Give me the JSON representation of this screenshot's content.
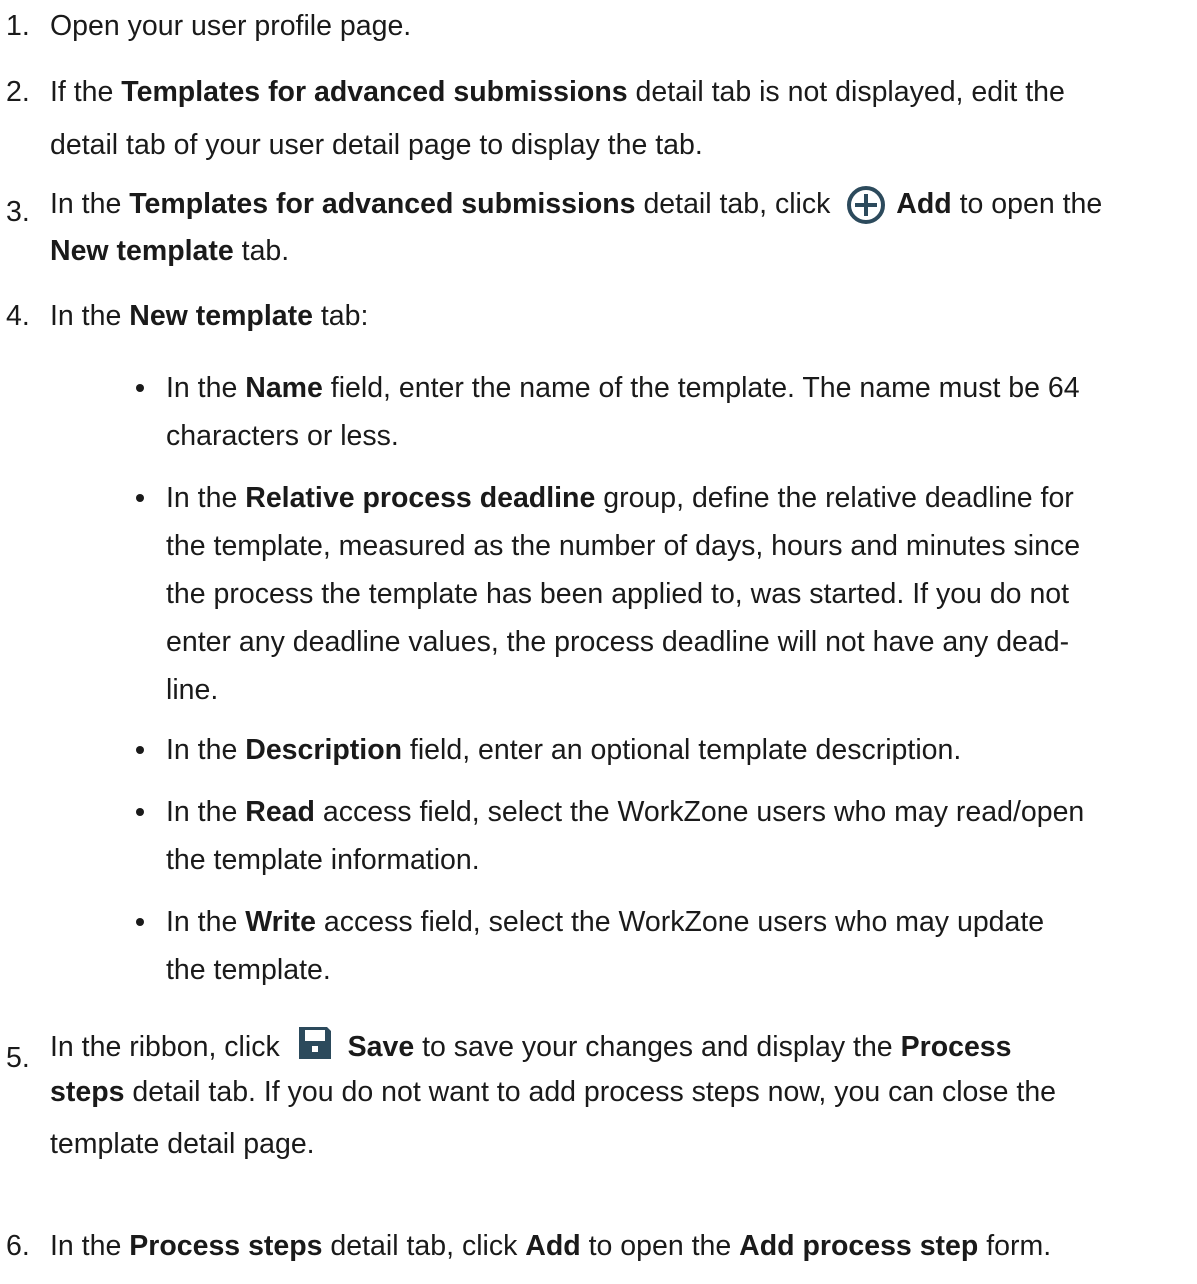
{
  "steps": [
    {
      "number": "1.",
      "text": "Open your user profile page."
    },
    {
      "number": "2.",
      "a": "If the ",
      "b1": "Templates for advanced submissions",
      "line1_rest": " detail tab is not displayed, edit the",
      "line2": "detail tab of your user detail page to display the tab."
    },
    {
      "number": "3.",
      "a": "In the ",
      "b1": "Templates for advanced submissions",
      "c": " detail tab, click ",
      "icon": "add-circle-icon",
      "b2": "Add",
      "d": " to open the",
      "b3": "New template",
      "e": " tab."
    },
    {
      "number": "4.",
      "a": "In the ",
      "b1": "New template",
      "c": " tab:"
    },
    {
      "number": "5.",
      "a": "In the ribbon, click ",
      "icon": "save-icon",
      "b1": "Save",
      "c": " to save your changes and display the ",
      "b2": "Process",
      "line2_b": "steps",
      "line2_rest": " detail tab. If you do not want to add process steps now, you can close the",
      "line3": "template detail page."
    },
    {
      "number": "6.",
      "a": "In the ",
      "b1": "Process steps",
      "c": " detail tab, click ",
      "b2": "Add",
      "d": " to open the ",
      "b3": "Add process step",
      "e": " form."
    }
  ],
  "bullets": [
    {
      "a": "In the ",
      "b": "Name",
      "line1_rest": " field, enter the name of the template. The name must be 64",
      "line2": "characters or less."
    },
    {
      "a": "In the ",
      "b": "Relative process deadline",
      "line1_rest": " group, define the relative deadline for",
      "line2": "the template, measured as the number of days, hours and minutes since",
      "line3": "the process the template has been applied to, was started. If you do not",
      "line4": "enter any deadline values, the process deadline will not have any dead-",
      "line5": "line."
    },
    {
      "a": "In the ",
      "b": "Description",
      "line1_rest": " field, enter an optional template description."
    },
    {
      "a": "In the ",
      "b": "Read",
      "line1_rest": " access field, select the WorkZone users who may read/open",
      "line2": "the template information."
    },
    {
      "a": "In the ",
      "b": "Write",
      "line1_rest": " access field, select the WorkZone users who may update",
      "line2": "the template."
    }
  ],
  "colors": {
    "text": "#1a1a1a",
    "icon_fill": "#2c4a5c"
  }
}
